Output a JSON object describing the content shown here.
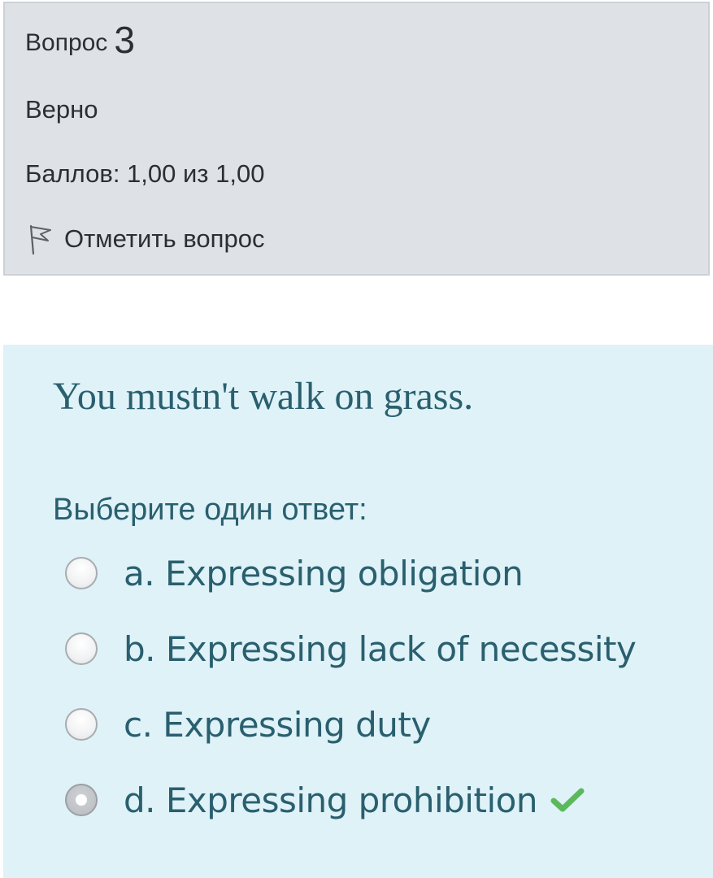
{
  "info": {
    "question_label": "Вопрос",
    "question_number": "3",
    "state": "Верно",
    "grade": "Баллов: 1,00 из 1,00",
    "flag_label": "Отметить вопрос",
    "flag_icon": "flag-outline-icon"
  },
  "question": {
    "text": "You mustn't walk on grass.",
    "prompt": "Выберите один ответ:",
    "options": [
      {
        "label": "a. Expressing obligation",
        "checked": false
      },
      {
        "label": "b. Expressing lack of necessity",
        "checked": false
      },
      {
        "label": "c. Expressing duty",
        "checked": false
      },
      {
        "label": "d. Expressing prohibition",
        "checked": true,
        "correct": true
      }
    ]
  },
  "colors": {
    "info_bg": "#dee2e6",
    "content_bg": "#def2f8",
    "text_teal": "#2a5f6e",
    "correct_green": "#5cb85c"
  }
}
